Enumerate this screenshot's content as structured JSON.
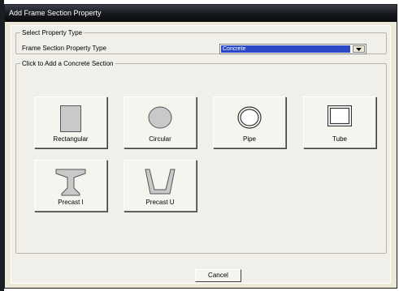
{
  "window": {
    "title": "Add Frame Section Property"
  },
  "property_type_group": {
    "legend": "Select Property Type",
    "label": "Frame Section Property Type",
    "selected_value": "Concrete"
  },
  "section_group": {
    "legend": "Click to Add a Concrete Section",
    "buttons": [
      {
        "label": "Rectangular",
        "icon": "rectangular-section-icon"
      },
      {
        "label": "Circular",
        "icon": "circular-section-icon"
      },
      {
        "label": "Pipe",
        "icon": "pipe-section-icon"
      },
      {
        "label": "Tube",
        "icon": "tube-section-icon"
      },
      {
        "label": "Precast I",
        "icon": "precast-i-section-icon"
      },
      {
        "label": "Precast U",
        "icon": "precast-u-section-icon"
      }
    ]
  },
  "actions": {
    "cancel_label": "Cancel"
  },
  "colors": {
    "selection": "#2a49c7",
    "section_fill": "#c9c9c9",
    "dialog_face": "#f0efe9"
  }
}
